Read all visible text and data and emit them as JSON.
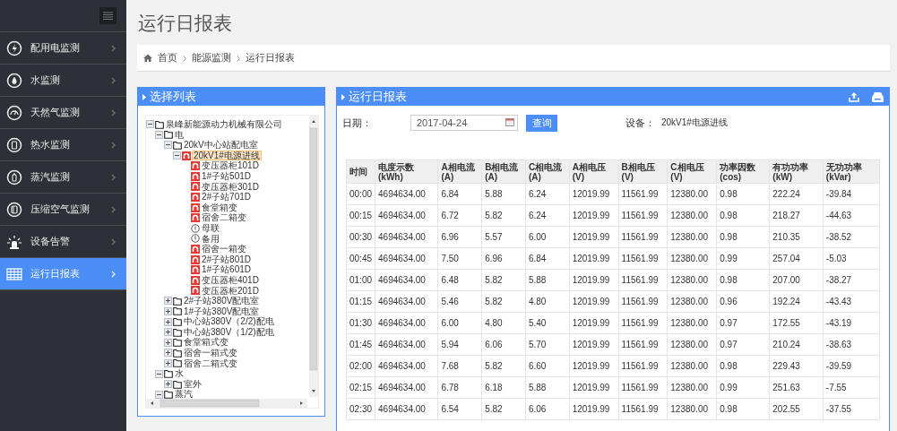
{
  "sidebar": {
    "items": [
      {
        "label": "配用电监测",
        "selected": false
      },
      {
        "label": "水监测",
        "selected": false
      },
      {
        "label": "天然气监测",
        "selected": false
      },
      {
        "label": "热水监测",
        "selected": false
      },
      {
        "label": "蒸汽监测",
        "selected": false
      },
      {
        "label": "压缩空气监测",
        "selected": false
      },
      {
        "label": "设备告警",
        "selected": false
      },
      {
        "label": "运行日报表",
        "selected": true
      }
    ]
  },
  "page_title": "运行日报表",
  "breadcrumb": [
    "首页",
    "能源监测",
    "运行日报表"
  ],
  "tree_panel": {
    "title": "选择列表",
    "tree": [
      {
        "label": "泉峰新能源动力机械有限公司",
        "kind": "folder",
        "expanded": true,
        "selected": false,
        "children": [
          {
            "label": "电",
            "kind": "folder",
            "expanded": true,
            "selected": false,
            "children": [
              {
                "label": "20kV中心站配电室",
                "kind": "folder",
                "expanded": true,
                "selected": false,
                "children": [
                  {
                    "label": "20kV1#电源进线",
                    "kind": "meter",
                    "expanded": true,
                    "selected": true,
                    "children": [
                      {
                        "label": "变压器柜101D",
                        "kind": "meter",
                        "selected": false
                      },
                      {
                        "label": "1#子站501D",
                        "kind": "meter",
                        "selected": false
                      },
                      {
                        "label": "变压器柜301D",
                        "kind": "meter",
                        "selected": false
                      },
                      {
                        "label": "2#子站701D",
                        "kind": "meter",
                        "selected": false
                      },
                      {
                        "label": "食堂箱变",
                        "kind": "meter",
                        "selected": false
                      },
                      {
                        "label": "宿舍二箱变",
                        "kind": "meter",
                        "selected": false
                      },
                      {
                        "label": "母联",
                        "kind": "idle",
                        "selected": false
                      },
                      {
                        "label": "备用",
                        "kind": "idle",
                        "selected": false
                      },
                      {
                        "label": "宿舍一箱变",
                        "kind": "meter",
                        "selected": false
                      },
                      {
                        "label": "2#子站801D",
                        "kind": "meter",
                        "selected": false
                      },
                      {
                        "label": "1#子站601D",
                        "kind": "meter",
                        "selected": false
                      },
                      {
                        "label": "变压器柜401D",
                        "kind": "meter",
                        "selected": false
                      },
                      {
                        "label": "变压器柜201D",
                        "kind": "meter",
                        "selected": false
                      }
                    ]
                  }
                ]
              },
              {
                "label": "2#子站380V配电室",
                "kind": "folder",
                "expanded": false,
                "selected": false
              },
              {
                "label": "1#子站380V配电室",
                "kind": "folder",
                "expanded": false,
                "selected": false
              },
              {
                "label": "中心站380V（2/2)配电",
                "kind": "folder",
                "expanded": false,
                "selected": false
              },
              {
                "label": "中心站380V（1/2)配电",
                "kind": "folder",
                "expanded": false,
                "selected": false
              },
              {
                "label": "食堂箱式变",
                "kind": "folder",
                "expanded": false,
                "selected": false
              },
              {
                "label": "宿舍一箱式变",
                "kind": "folder",
                "expanded": false,
                "selected": false
              },
              {
                "label": "宿舍二箱式变",
                "kind": "folder",
                "expanded": false,
                "selected": false
              }
            ]
          },
          {
            "label": "水",
            "kind": "folder",
            "expanded": true,
            "selected": false,
            "children": [
              {
                "label": "室外",
                "kind": "folder",
                "expanded": false,
                "selected": false
              }
            ]
          },
          {
            "label": "蒸汽",
            "kind": "folder",
            "expanded": true,
            "selected": false
          }
        ]
      }
    ]
  },
  "report_panel": {
    "title": "运行日报表",
    "date_label": "日期：",
    "date_value": "2017-04-24",
    "query_button": "查询",
    "device_label": "设备：",
    "device_value": "20kV1#电源进线",
    "table": {
      "columns": [
        "时间",
        "电度示数(kWh)",
        "A相电流(A)",
        "B相电流(A)",
        "C相电流(A)",
        "A相电压(V)",
        "B相电压(V)",
        "C相电压(V)",
        "功率因数(cos)",
        "有功功率(kW)",
        "无功功率(kVar)"
      ],
      "rows": [
        [
          "00:00",
          "4694634.00",
          "6.84",
          "5.88",
          "6.24",
          "12019.99",
          "11561.99",
          "12380.00",
          "0.98",
          "222.24",
          "-39.84"
        ],
        [
          "00:15",
          "4694634.00",
          "6.72",
          "5.82",
          "6.24",
          "12019.99",
          "11561.99",
          "12380.00",
          "0.98",
          "218.27",
          "-44.63"
        ],
        [
          "00:30",
          "4694634.00",
          "6.96",
          "5.57",
          "6.00",
          "12019.99",
          "11561.99",
          "12380.00",
          "0.98",
          "210.35",
          "-38.52"
        ],
        [
          "00:45",
          "4694634.00",
          "7.50",
          "6.96",
          "6.84",
          "12019.99",
          "11561.99",
          "12380.00",
          "0.99",
          "257.04",
          "-5.03"
        ],
        [
          "01:00",
          "4694634.00",
          "6.48",
          "5.82",
          "5.88",
          "12019.99",
          "11561.99",
          "12380.00",
          "0.98",
          "207.00",
          "-38.27"
        ],
        [
          "01:15",
          "4694634.00",
          "5.46",
          "5.82",
          "4.80",
          "12019.99",
          "11561.99",
          "12380.00",
          "0.96",
          "192.24",
          "-43.43"
        ],
        [
          "01:30",
          "4694634.00",
          "6.00",
          "4.80",
          "5.40",
          "12019.99",
          "11561.99",
          "12380.00",
          "0.97",
          "172.55",
          "-43.19"
        ],
        [
          "01:45",
          "4694634.00",
          "5.94",
          "6.06",
          "5.70",
          "12019.99",
          "11561.99",
          "12380.00",
          "0.97",
          "210.24",
          "-38.63"
        ],
        [
          "02:00",
          "4694634.00",
          "7.68",
          "5.82",
          "6.60",
          "12019.99",
          "11561.99",
          "12380.00",
          "0.98",
          "229.43",
          "-39.59"
        ],
        [
          "02:15",
          "4694634.00",
          "6.78",
          "6.18",
          "5.88",
          "12019.99",
          "11561.99",
          "12380.00",
          "0.99",
          "251.63",
          "-7.55"
        ],
        [
          "02:30",
          "4694634.00",
          "6.54",
          "5.82",
          "6.06",
          "12019.99",
          "11561.99",
          "12380.00",
          "0.98",
          "202.55",
          "-37.55"
        ]
      ]
    }
  }
}
